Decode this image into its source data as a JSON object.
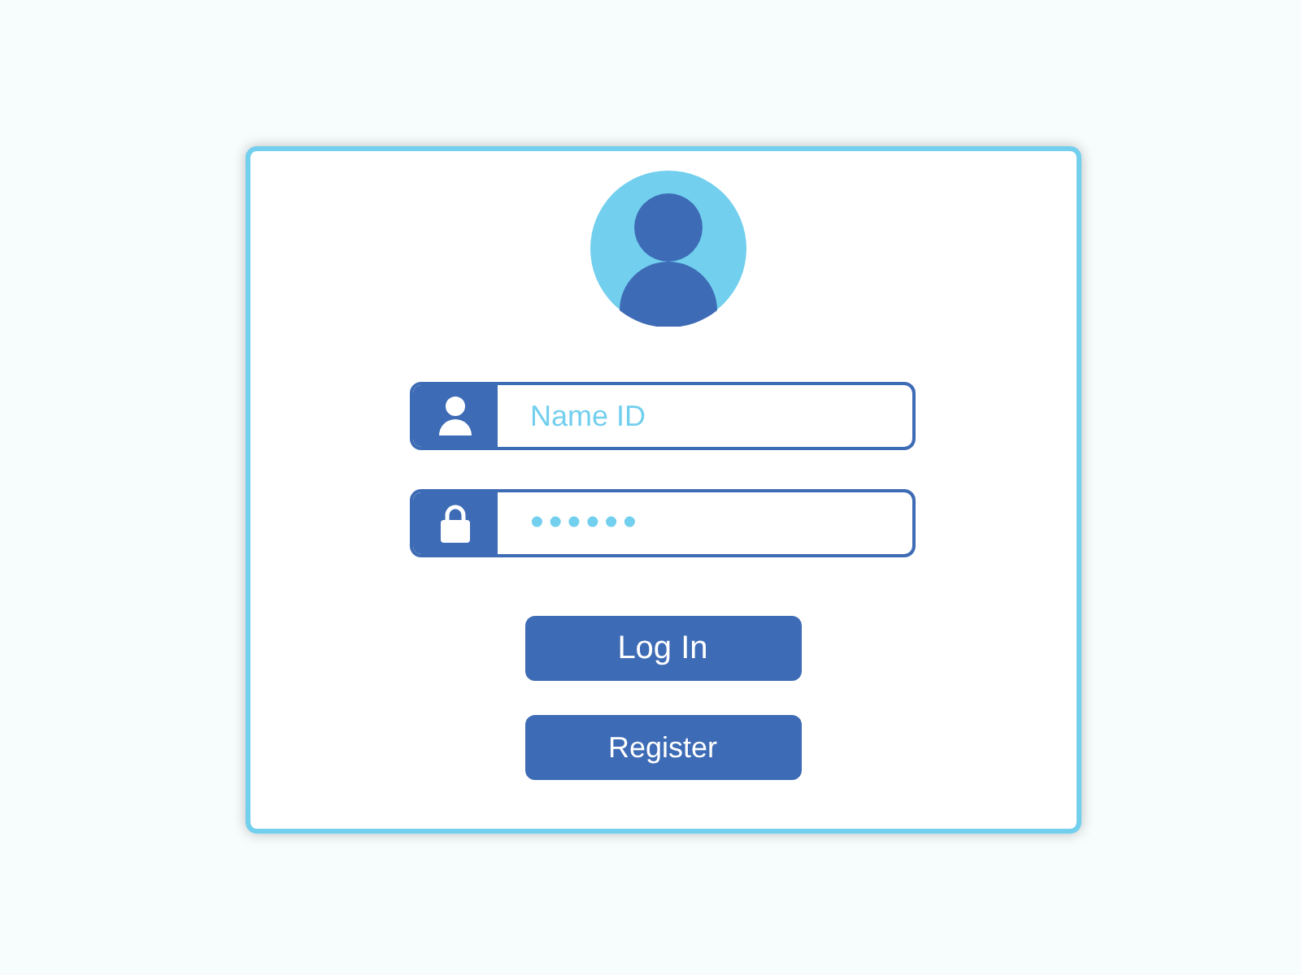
{
  "fields": [
    {
      "kind": "text",
      "placeholder": "Name ID"
    },
    {
      "kind": "password",
      "value": "••••••"
    }
  ],
  "buttons": [
    {
      "label": "Log In"
    },
    {
      "label": "Register"
    }
  ]
}
